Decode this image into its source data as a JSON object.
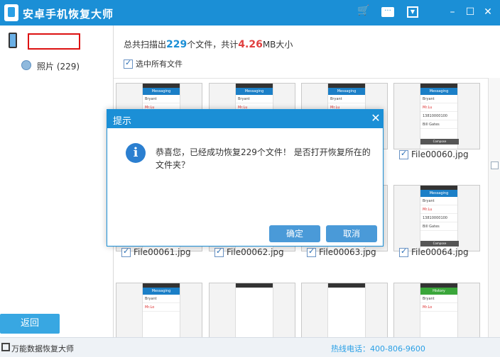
{
  "app": {
    "title": "安卓手机恢复大师",
    "controls": {
      "cart": "🛒",
      "message": "···",
      "dropdown": "▼",
      "minimize": "–",
      "maximize": "☐",
      "close": "✕"
    }
  },
  "sidebar": {
    "device_name": "",
    "items": [
      {
        "label": "照片 (229)",
        "icon": "photo-icon"
      }
    ],
    "back_button": "返回"
  },
  "main": {
    "summary_prefix": "总共扫描出",
    "file_count": "229",
    "summary_mid": "个文件，共计",
    "total_size": "4.26",
    "summary_suffix": "MB大小",
    "select_all_label": "选中所有文件",
    "files": [
      {
        "name": "",
        "lines": [
          "Messaging",
          "Bryant",
          "Mr.Lu",
          "",
          ""
        ]
      },
      {
        "name": "",
        "lines": [
          "Messaging",
          "Bryant",
          "Mr.Lu",
          "",
          ""
        ]
      },
      {
        "name": "",
        "lines": [
          "Messaging",
          "Bryant",
          "Mr.Lu",
          "",
          ""
        ]
      },
      {
        "name": "File00060.jpg",
        "lines": [
          "Messaging",
          "Bryant",
          "Mr.Lu",
          "13810000100",
          "Bill Gates"
        ]
      },
      {
        "name": "File00061.jpg",
        "lines": [
          "",
          "",
          "",
          "",
          ""
        ]
      },
      {
        "name": "File00062.jpg",
        "lines": [
          "",
          "",
          "",
          "",
          ""
        ]
      },
      {
        "name": "File00063.jpg",
        "lines": [
          "",
          "",
          "",
          "",
          ""
        ]
      },
      {
        "name": "File00064.jpg",
        "lines": [
          "Messaging",
          "Bryant",
          "Mr.Lu",
          "13810000100",
          "Bill Gates"
        ]
      },
      {
        "name": "",
        "lines": [
          "Messaging",
          "Bryant",
          "Mr.Lo",
          "",
          ""
        ]
      },
      {
        "name": "",
        "lines": [
          "",
          "",
          "",
          "",
          ""
        ]
      },
      {
        "name": "",
        "lines": [
          "",
          "",
          "",
          "",
          ""
        ]
      },
      {
        "name": "",
        "lines": [
          "History",
          "Bryant",
          "Mr.Lo",
          "",
          ""
        ]
      }
    ],
    "compose_label": "Compose"
  },
  "dialog": {
    "title": "提示",
    "message": "恭喜您，已经成功恢复229个文件！ 是否打开恢复所在的文件夹？",
    "ok_label": "确定",
    "cancel_label": "取消"
  },
  "statusbar": {
    "app_name": "万能数据恢复大师",
    "hotline": "热线电话：400-806-9600"
  },
  "colors": {
    "accent": "#1b8fd6",
    "highlight_red": "#e04040",
    "button_blue": "#4a9ad8"
  }
}
